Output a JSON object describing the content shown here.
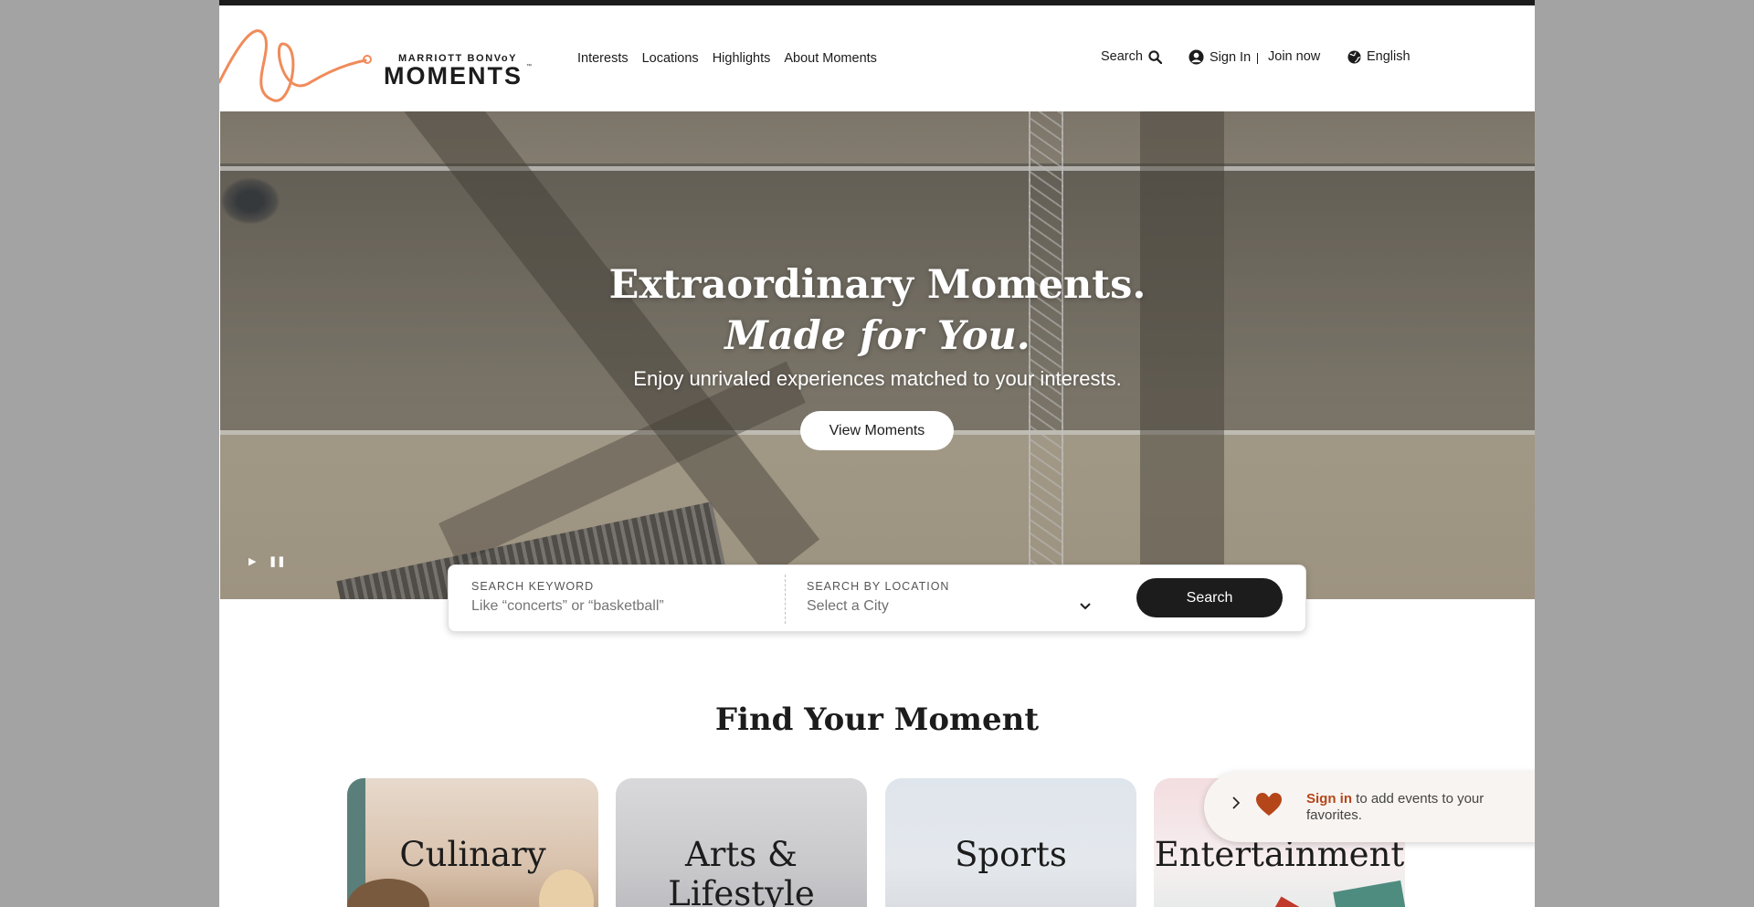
{
  "header": {
    "logo_brand": "MARRIOTT BONVoY",
    "logo_name": "MOMENTS",
    "logo_tm": "™",
    "nav": [
      "Interests",
      "Locations",
      "Highlights",
      "About Moments"
    ],
    "search_label": "Search",
    "signin_label": "Sign In",
    "join_label": "Join now",
    "language_label": "English"
  },
  "hero": {
    "title_line1": "Extraordinary Moments.",
    "title_line2": "Made for You.",
    "subtitle": "Enjoy unrivaled experiences matched to your interests.",
    "cta_label": "View Moments"
  },
  "search": {
    "keyword_label": "SEARCH KEYWORD",
    "keyword_placeholder": "Like “concerts” or “basketball”",
    "location_label": "SEARCH BY LOCATION",
    "location_value": "Select a City",
    "button_label": "Search"
  },
  "find": {
    "title": "Find Your Moment",
    "categories": [
      "Culinary",
      "Arts & Lifestyle",
      "Sports",
      "Entertainment"
    ]
  },
  "toast": {
    "link_text": "Sign in",
    "message": " to add events to your favorites."
  },
  "colors": {
    "brand_dark": "#1c1c1c",
    "accent_orange": "#f08b5a",
    "signin_link": "#b5461a"
  },
  "icons": [
    "search-icon",
    "user-icon",
    "globe-icon",
    "play-icon",
    "pause-icon",
    "chevron-down-icon",
    "chevron-right-icon",
    "heart-icon"
  ]
}
